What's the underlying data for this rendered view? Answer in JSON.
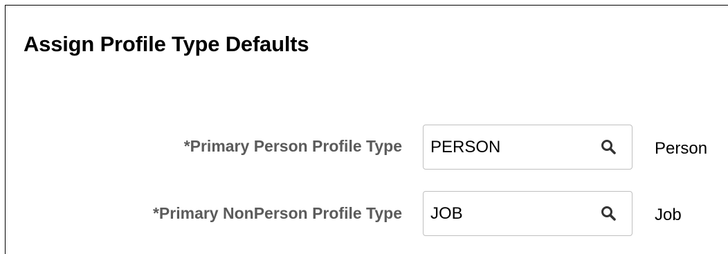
{
  "page": {
    "title": "Assign Profile Type Defaults"
  },
  "fields": [
    {
      "label": "*Primary Person Profile Type",
      "value": "PERSON",
      "description": "Person",
      "icon": "search-icon"
    },
    {
      "label": "*Primary NonPerson Profile Type",
      "value": "JOB",
      "description": "Job",
      "icon": "search-icon"
    }
  ],
  "colors": {
    "label": "#5b5b5b",
    "text": "#000000",
    "input_border": "#bfbfbf",
    "frame_border": "#000000"
  }
}
